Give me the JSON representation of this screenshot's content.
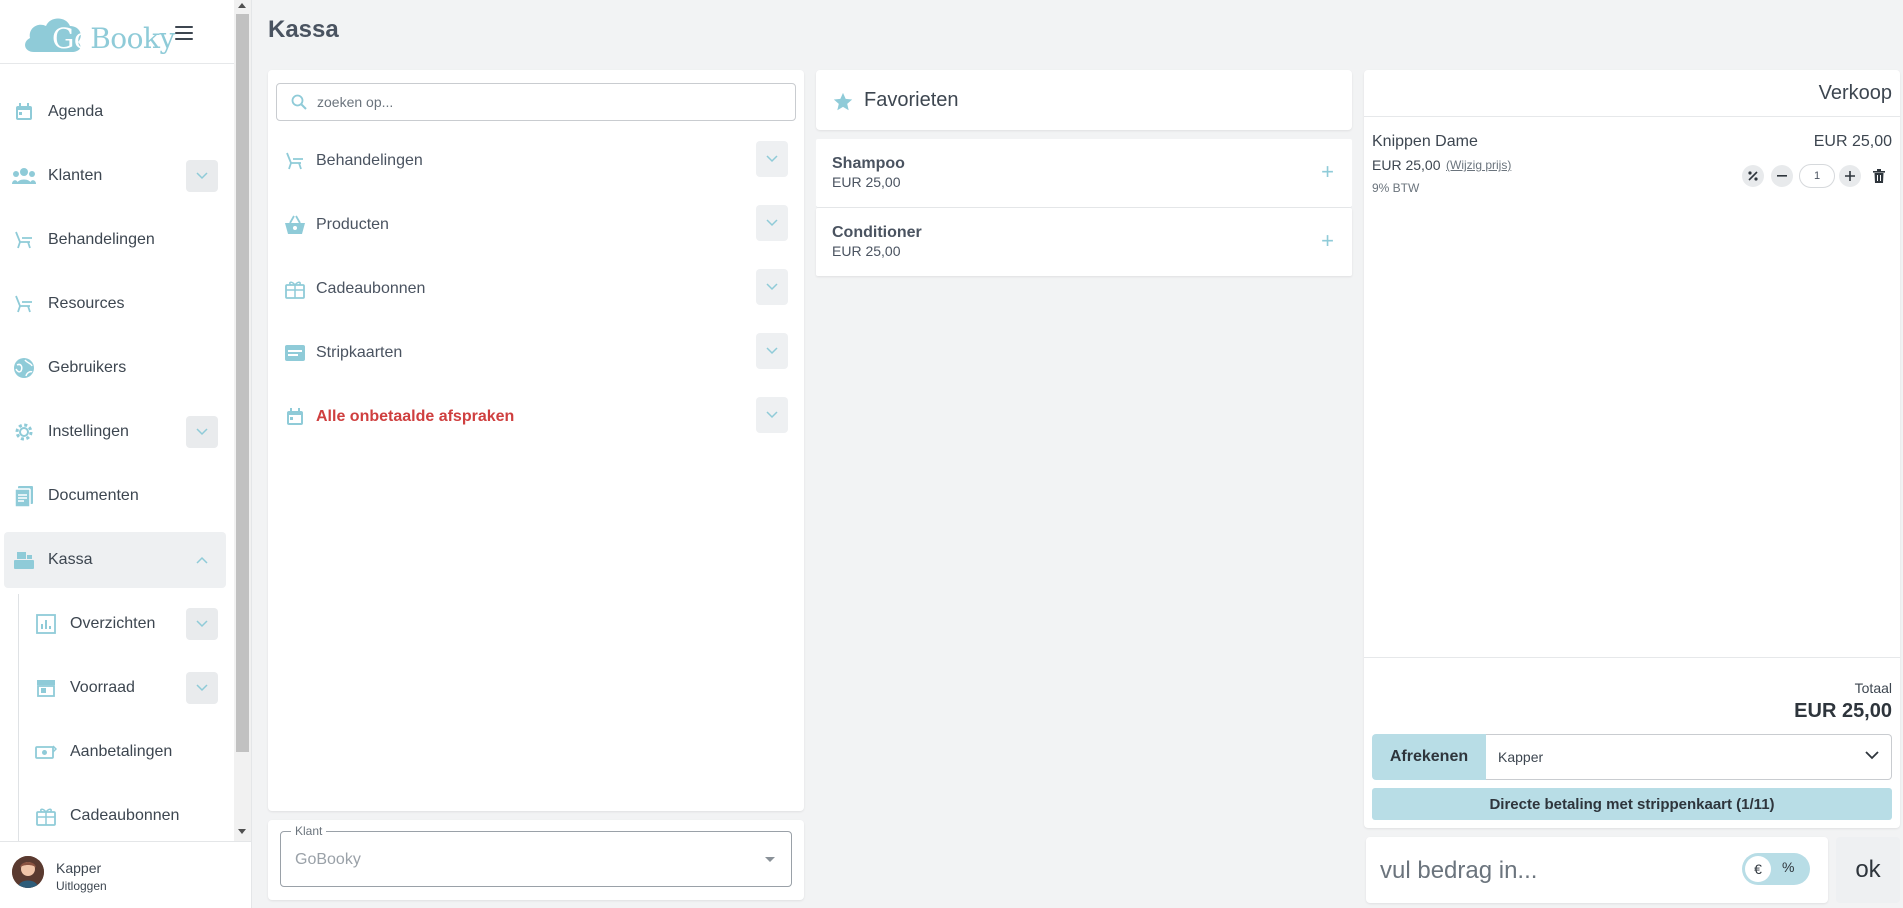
{
  "app": {
    "logo_text_go": "Go",
    "logo_text_booky": "Booky",
    "page_title": "Kassa"
  },
  "colors": {
    "accent": "#b8dde6",
    "accent_icon": "#8fcbd8",
    "alert_red": "#cf3f3f"
  },
  "sidebar": {
    "items": [
      {
        "label": "Agenda",
        "icon": "calendar-icon",
        "chevron": "none"
      },
      {
        "label": "Klanten",
        "icon": "users-icon",
        "chevron": "down"
      },
      {
        "label": "Behandelingen",
        "icon": "chair-icon",
        "chevron": "none"
      },
      {
        "label": "Resources",
        "icon": "chair-icon",
        "chevron": "none"
      },
      {
        "label": "Gebruikers",
        "icon": "globe-icon",
        "chevron": "none"
      },
      {
        "label": "Instellingen",
        "icon": "gear-icon",
        "chevron": "down"
      },
      {
        "label": "Documenten",
        "icon": "document-icon",
        "chevron": "none"
      },
      {
        "label": "Kassa",
        "icon": "register-icon",
        "chevron": "up",
        "active": true
      }
    ],
    "sub_items": [
      {
        "label": "Overzichten",
        "icon": "bar-chart-icon",
        "chevron": "down"
      },
      {
        "label": "Voorraad",
        "icon": "store-icon",
        "chevron": "down"
      },
      {
        "label": "Aanbetalingen",
        "icon": "money-icon",
        "chevron": "none"
      },
      {
        "label": "Cadeaubonnen",
        "icon": "gift-icon",
        "chevron": "none"
      }
    ],
    "user": {
      "name": "Kapper",
      "logout": "Uitloggen"
    }
  },
  "catalog": {
    "search_placeholder": "zoeken op...",
    "categories": [
      {
        "label": "Behandelingen",
        "icon": "chair-icon"
      },
      {
        "label": "Producten",
        "icon": "basket-icon"
      },
      {
        "label": "Cadeaubonnen",
        "icon": "gift-icon"
      },
      {
        "label": "Stripkaarten",
        "icon": "card-icon"
      },
      {
        "label": "Alle onbetaalde afspraken",
        "icon": "calendar-icon",
        "alert": true
      }
    ],
    "klant_label": "Klant",
    "klant_value": "GoBooky"
  },
  "favorites": {
    "title": "Favorieten",
    "items": [
      {
        "name": "Shampoo",
        "price": "EUR 25,00"
      },
      {
        "name": "Conditioner",
        "price": "EUR 25,00"
      }
    ]
  },
  "sale": {
    "title": "Verkoop",
    "lines": [
      {
        "name": "Knippen Dame",
        "total": "EUR 25,00",
        "price": "EUR 25,00",
        "edit_label": "(Wijzig prijs)",
        "vat": "9% BTW",
        "quantity": "1"
      }
    ],
    "total_label": "Totaal",
    "total_value": "EUR 25,00",
    "checkout_label": "Afrekenen",
    "payment_method": "Kapper",
    "strip_button": "Directe betaling met strippenkaart (1/11)",
    "amount_placeholder": "vul bedrag in...",
    "currency_symbol": "€",
    "percent_symbol": "%",
    "ok_label": "ok"
  }
}
